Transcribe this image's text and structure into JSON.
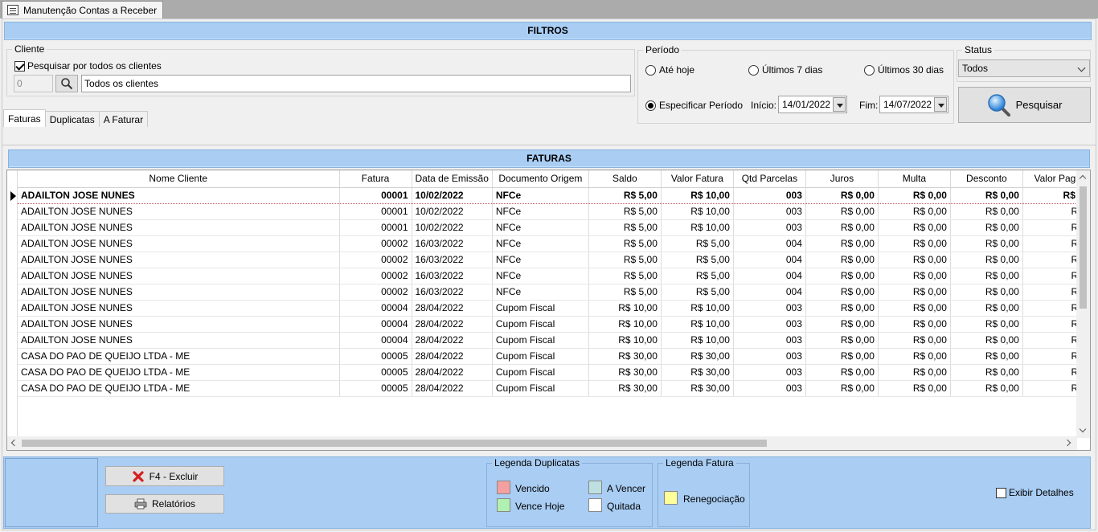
{
  "window": {
    "tab_title": "Manutenção Contas a Receber"
  },
  "filters": {
    "header": "FILTROS",
    "client": {
      "legend": "Cliente",
      "all_clients_label": "Pesquisar por todos os clientes",
      "all_clients_checked": true,
      "code_value": "0",
      "name_value": "Todos os clientes"
    },
    "period": {
      "legend": "Período",
      "opt_today": "Até hoje",
      "opt_7": "Últimos 7 dias",
      "opt_30": "Últimos 30 dias",
      "opt_custom": "Especificar Período",
      "selected": "Especificar Período",
      "start_label": "Início:",
      "start_value": "14/01/2022",
      "end_label": "Fim:",
      "end_value": "14/07/2022"
    },
    "status": {
      "legend": "Status",
      "value": "Todos"
    },
    "search_button": "Pesquisar"
  },
  "tabs": [
    {
      "label": "Faturas",
      "active": true
    },
    {
      "label": "Duplicatas",
      "active": false
    },
    {
      "label": "A Faturar",
      "active": false
    }
  ],
  "grid": {
    "header": "FATURAS",
    "columns": [
      "Nome Cliente",
      "Fatura",
      "Data de Emissão",
      "Documento Origem",
      "Saldo",
      "Valor Fatura",
      "Qtd Parcelas",
      "Juros",
      "Multa",
      "Desconto",
      "Valor Pag"
    ],
    "rows": [
      [
        "ADAILTON JOSE NUNES",
        "00001",
        "10/02/2022",
        "NFCe",
        "R$ 5,00",
        "R$ 10,00",
        "003",
        "R$ 0,00",
        "R$ 0,00",
        "R$ 0,00",
        "R$ 5"
      ],
      [
        "ADAILTON JOSE NUNES",
        "00001",
        "10/02/2022",
        "NFCe",
        "R$ 5,00",
        "R$ 10,00",
        "003",
        "R$ 0,00",
        "R$ 0,00",
        "R$ 0,00",
        "R$"
      ],
      [
        "ADAILTON JOSE NUNES",
        "00001",
        "10/02/2022",
        "NFCe",
        "R$ 5,00",
        "R$ 10,00",
        "003",
        "R$ 0,00",
        "R$ 0,00",
        "R$ 0,00",
        "R$"
      ],
      [
        "ADAILTON JOSE NUNES",
        "00002",
        "16/03/2022",
        "NFCe",
        "R$ 5,00",
        "R$ 5,00",
        "004",
        "R$ 0,00",
        "R$ 0,00",
        "R$ 0,00",
        "R$"
      ],
      [
        "ADAILTON JOSE NUNES",
        "00002",
        "16/03/2022",
        "NFCe",
        "R$ 5,00",
        "R$ 5,00",
        "004",
        "R$ 0,00",
        "R$ 0,00",
        "R$ 0,00",
        "R$"
      ],
      [
        "ADAILTON JOSE NUNES",
        "00002",
        "16/03/2022",
        "NFCe",
        "R$ 5,00",
        "R$ 5,00",
        "004",
        "R$ 0,00",
        "R$ 0,00",
        "R$ 0,00",
        "R$"
      ],
      [
        "ADAILTON JOSE NUNES",
        "00002",
        "16/03/2022",
        "NFCe",
        "R$ 5,00",
        "R$ 5,00",
        "004",
        "R$ 0,00",
        "R$ 0,00",
        "R$ 0,00",
        "R$"
      ],
      [
        "ADAILTON JOSE NUNES",
        "00004",
        "28/04/2022",
        "Cupom Fiscal",
        "R$ 10,00",
        "R$ 10,00",
        "003",
        "R$ 0,00",
        "R$ 0,00",
        "R$ 0,00",
        "R$"
      ],
      [
        "ADAILTON JOSE NUNES",
        "00004",
        "28/04/2022",
        "Cupom Fiscal",
        "R$ 10,00",
        "R$ 10,00",
        "003",
        "R$ 0,00",
        "R$ 0,00",
        "R$ 0,00",
        "R$"
      ],
      [
        "ADAILTON JOSE NUNES",
        "00004",
        "28/04/2022",
        "Cupom Fiscal",
        "R$ 10,00",
        "R$ 10,00",
        "003",
        "R$ 0,00",
        "R$ 0,00",
        "R$ 0,00",
        "R$"
      ],
      [
        "CASA DO PAO DE QUEIJO LTDA - ME",
        "00005",
        "28/04/2022",
        "Cupom Fiscal",
        "R$ 30,00",
        "R$ 30,00",
        "003",
        "R$ 0,00",
        "R$ 0,00",
        "R$ 0,00",
        "R$"
      ],
      [
        "CASA DO PAO DE QUEIJO LTDA - ME",
        "00005",
        "28/04/2022",
        "Cupom Fiscal",
        "R$ 30,00",
        "R$ 30,00",
        "003",
        "R$ 0,00",
        "R$ 0,00",
        "R$ 0,00",
        "R$"
      ],
      [
        "CASA DO PAO DE QUEIJO LTDA - ME",
        "00005",
        "28/04/2022",
        "Cupom Fiscal",
        "R$ 30,00",
        "R$ 30,00",
        "003",
        "R$ 0,00",
        "R$ 0,00",
        "R$ 0,00",
        "R$"
      ]
    ],
    "selected_row": 0
  },
  "bottom": {
    "delete_button": "F4 - Excluir",
    "reports_button": "Relatórios",
    "legend_dup": {
      "title": "Legenda Duplicatas",
      "items": [
        {
          "label": "Vencido",
          "color": "#f4a0a0"
        },
        {
          "label": "A Vencer",
          "color": "#bfe0e0"
        },
        {
          "label": "Vence Hoje",
          "color": "#b0f0b0"
        },
        {
          "label": "Quitada",
          "color": "#ffffff"
        }
      ]
    },
    "legend_fat": {
      "title": "Legenda Fatura",
      "items": [
        {
          "label": "Renegociação",
          "color": "#ffff99"
        }
      ]
    },
    "show_details_label": "Exibir Detalhes",
    "show_details_checked": false
  }
}
